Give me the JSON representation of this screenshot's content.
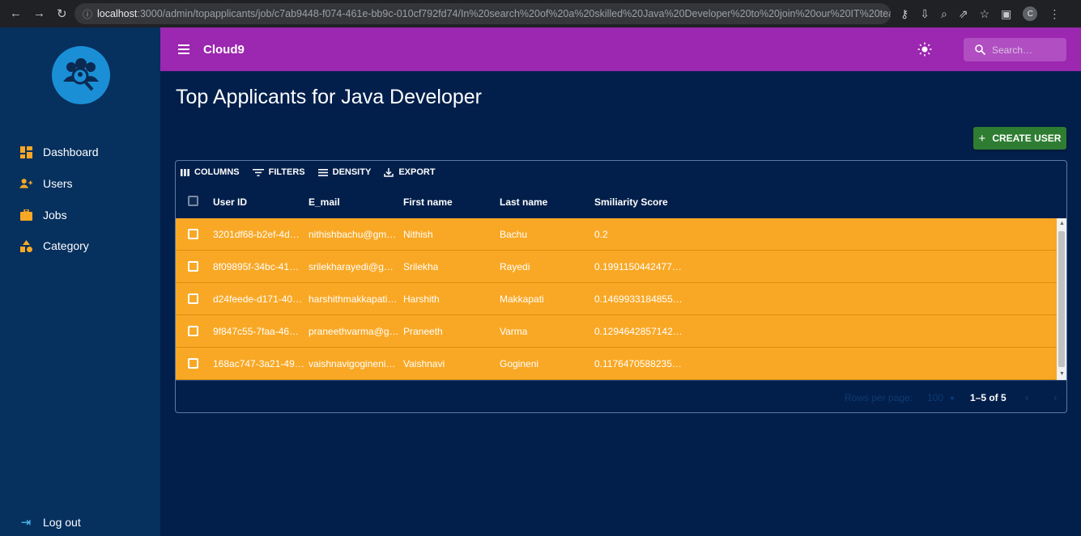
{
  "browser": {
    "url_host": "localhost",
    "url_rest": ":3000/admin/topapplicants/job/c7ab9448-f074-461e-bb9c-010cf792fd74/In%20search%20of%20a%20skilled%20Java%20Developer%20to%20join%20our%20IT%20team....",
    "profile_initial": "C"
  },
  "sidebar": {
    "items": [
      {
        "label": "Dashboard",
        "icon": "dashboard-icon",
        "color": "#f9a825"
      },
      {
        "label": "Users",
        "icon": "users-icon",
        "color": "#f9a825"
      },
      {
        "label": "Jobs",
        "icon": "briefcase-icon",
        "color": "#f9a825"
      },
      {
        "label": "Category",
        "icon": "category-icon",
        "color": "#f9a825"
      }
    ],
    "logout": "Log out"
  },
  "appbar": {
    "brand": "Cloud9",
    "search_placeholder": "Search…",
    "color": "#9c27b0"
  },
  "page": {
    "title": "Top Applicants for Java Developer",
    "create_button": "CREATE USER"
  },
  "grid": {
    "toolbar": {
      "columns": "COLUMNS",
      "filters": "FILTERS",
      "density": "DENSITY",
      "export": "EXPORT"
    },
    "headers": {
      "user_id": "User ID",
      "email": "E_mail",
      "first_name": "First name",
      "last_name": "Last name",
      "score": "Smiliarity Score"
    },
    "rows": [
      {
        "user_id": "3201df68-b2ef-4d…",
        "email": "nithishbachu@gm…",
        "first_name": "Nithish",
        "last_name": "Bachu",
        "score": "0.2"
      },
      {
        "user_id": "8f09895f-34bc-41…",
        "email": "srilekharayedi@g…",
        "first_name": "Srilekha",
        "last_name": "Rayedi",
        "score": "0.1991150442477…"
      },
      {
        "user_id": "d24feede-d171-40…",
        "email": "harshithmakkapati…",
        "first_name": "Harshith",
        "last_name": "Makkapati",
        "score": "0.1469933184855…"
      },
      {
        "user_id": "9f847c55-7faa-46…",
        "email": "praneethvarma@g…",
        "first_name": "Praneeth",
        "last_name": "Varma",
        "score": "0.1294642857142…"
      },
      {
        "user_id": "168ac747-3a21-49…",
        "email": "vaishnavigogineni…",
        "first_name": "Vaishnavi",
        "last_name": "Gogineni",
        "score": "0.1176470588235…"
      }
    ],
    "row_color": "#f9a825",
    "footer": {
      "rows_per_page_label": "Rows per page:",
      "rows_per_page_value": "100",
      "range": "1–5 of 5"
    }
  }
}
